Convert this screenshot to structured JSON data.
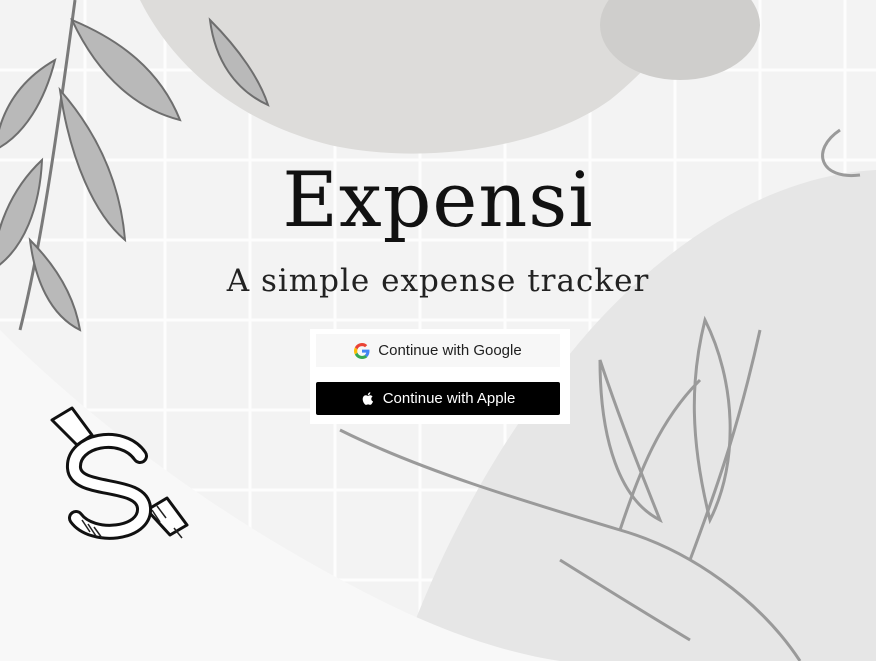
{
  "app": {
    "title": "Expensi",
    "tagline": "A simple expense tracker"
  },
  "auth": {
    "google_label": "Continue with Google",
    "apple_label": "Continue with Apple"
  },
  "icons": {
    "google": "google-g-icon",
    "apple": "apple-logo-icon",
    "decoration": "dollar-sign-sketch"
  },
  "colors": {
    "background": "#f3f3f3",
    "apple_button": "#000000",
    "google_button": "#f7f7f7",
    "title_text": "#111111"
  }
}
